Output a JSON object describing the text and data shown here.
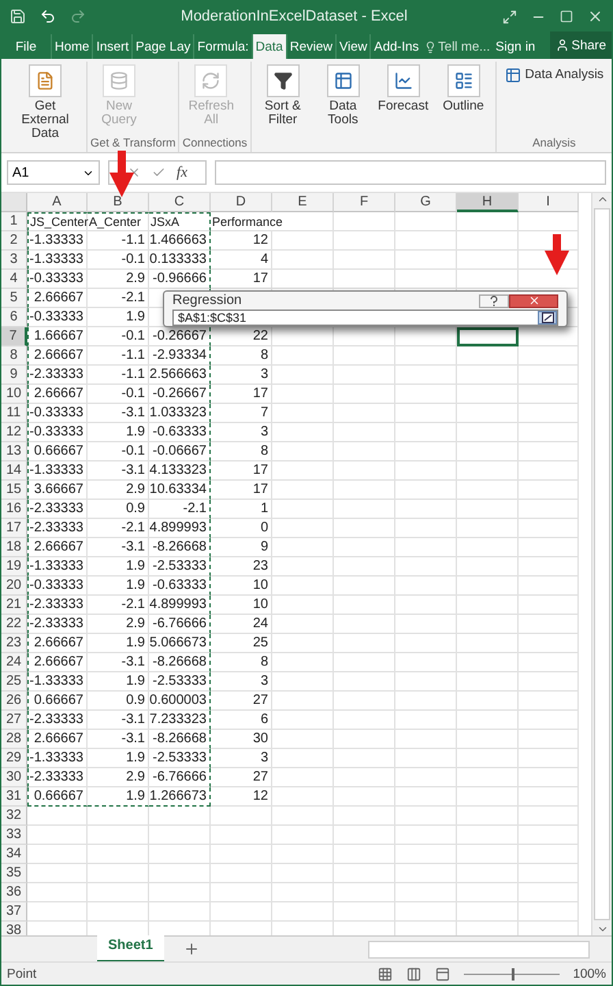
{
  "window": {
    "title": "ModerationInExcelDataset - Excel"
  },
  "tabs": [
    {
      "label": "File",
      "kind": "file",
      "selected": false
    },
    {
      "label": "Home",
      "kind": "tab",
      "selected": false
    },
    {
      "label": "Insert",
      "kind": "tab",
      "selected": false
    },
    {
      "label": "Page Lay",
      "kind": "tab",
      "selected": false
    },
    {
      "label": "Formula:",
      "kind": "tab",
      "selected": false
    },
    {
      "label": "Data",
      "kind": "tab",
      "selected": true
    },
    {
      "label": "Review",
      "kind": "tab",
      "selected": false
    },
    {
      "label": "View",
      "kind": "tab",
      "selected": false
    },
    {
      "label": "Add-Ins",
      "kind": "tab",
      "selected": false
    }
  ],
  "tell_me": {
    "placeholder": "Tell me..."
  },
  "sign_in": "Sign in",
  "share": "Share",
  "ribbon_groups": [
    {
      "buttons": [
        {
          "label": "Get External Data",
          "disabled": false
        }
      ]
    },
    {
      "label": "Get & Transform",
      "buttons": [
        {
          "label": "New Query",
          "disabled": true
        }
      ]
    },
    {
      "label": "Connections",
      "buttons": [
        {
          "label": "Refresh All",
          "disabled": true
        }
      ]
    },
    {
      "buttons": [
        {
          "label": "Sort & Filter",
          "disabled": false
        },
        {
          "label": "Data Tools",
          "disabled": false
        },
        {
          "label": "Forecast",
          "disabled": false
        },
        {
          "label": "Outline",
          "disabled": false
        }
      ]
    },
    {
      "label": "Analysis",
      "buttons": [
        {
          "label": "Data Analysis",
          "kind": "small",
          "disabled": false
        }
      ]
    }
  ],
  "formula_bar": {
    "name_box": "A1",
    "fx": "fx"
  },
  "columns": [
    {
      "label": "A",
      "selected": false,
      "in_marquee": true
    },
    {
      "label": "B",
      "selected": false,
      "in_marquee": true
    },
    {
      "label": "C",
      "selected": false,
      "in_marquee": true
    },
    {
      "label": "D",
      "selected": false,
      "in_marquee": false
    },
    {
      "label": "E",
      "selected": false,
      "in_marquee": false
    },
    {
      "label": "F",
      "selected": false,
      "in_marquee": false
    },
    {
      "label": "G",
      "selected": false,
      "in_marquee": false
    },
    {
      "label": "H",
      "selected": true,
      "in_marquee": false
    },
    {
      "label": "I",
      "selected": false,
      "in_marquee": false
    }
  ],
  "rows": [
    {
      "num": "1",
      "kind": "header",
      "selected": false,
      "in_marquee": true,
      "cells": [
        "JS_Center",
        "A_Center",
        "JSxA",
        "Performance"
      ]
    },
    {
      "num": "2",
      "kind": "data",
      "selected": false,
      "in_marquee": true,
      "cells": [
        "-1.33333",
        "-1.1",
        "1.466663",
        "12"
      ]
    },
    {
      "num": "3",
      "kind": "data",
      "selected": false,
      "in_marquee": true,
      "cells": [
        "-1.33333",
        "-0.1",
        "0.133333",
        "4"
      ]
    },
    {
      "num": "4",
      "kind": "data",
      "selected": false,
      "in_marquee": true,
      "cells": [
        "-0.33333",
        "2.9",
        "-0.96666",
        "17"
      ]
    },
    {
      "num": "5",
      "kind": "data",
      "selected": false,
      "in_marquee": true,
      "cells": [
        "2.66667",
        "-2.1",
        null,
        null
      ]
    },
    {
      "num": "6",
      "kind": "data",
      "selected": false,
      "in_marquee": true,
      "cells": [
        "-0.33333",
        "1.9",
        null,
        null
      ]
    },
    {
      "num": "7",
      "kind": "data",
      "selected": true,
      "in_marquee": true,
      "cells": [
        "1.66667",
        "-0.1",
        "-0.26667",
        "22"
      ]
    },
    {
      "num": "8",
      "kind": "data",
      "selected": false,
      "in_marquee": true,
      "cells": [
        "2.66667",
        "-1.1",
        "-2.93334",
        "8"
      ]
    },
    {
      "num": "9",
      "kind": "data",
      "selected": false,
      "in_marquee": true,
      "cells": [
        "-2.33333",
        "-1.1",
        "2.566663",
        "3"
      ]
    },
    {
      "num": "10",
      "kind": "data",
      "selected": false,
      "in_marquee": true,
      "cells": [
        "2.66667",
        "-0.1",
        "-0.26667",
        "17"
      ]
    },
    {
      "num": "11",
      "kind": "data",
      "selected": false,
      "in_marquee": true,
      "cells": [
        "-0.33333",
        "-3.1",
        "1.033323",
        "7"
      ]
    },
    {
      "num": "12",
      "kind": "data",
      "selected": false,
      "in_marquee": true,
      "cells": [
        "-0.33333",
        "1.9",
        "-0.63333",
        "3"
      ]
    },
    {
      "num": "13",
      "kind": "data",
      "selected": false,
      "in_marquee": true,
      "cells": [
        "0.66667",
        "-0.1",
        "-0.06667",
        "8"
      ]
    },
    {
      "num": "14",
      "kind": "data",
      "selected": false,
      "in_marquee": true,
      "cells": [
        "-1.33333",
        "-3.1",
        "4.133323",
        "17"
      ]
    },
    {
      "num": "15",
      "kind": "data",
      "selected": false,
      "in_marquee": true,
      "cells": [
        "3.66667",
        "2.9",
        "10.63334",
        "17"
      ]
    },
    {
      "num": "16",
      "kind": "data",
      "selected": false,
      "in_marquee": true,
      "cells": [
        "-2.33333",
        "0.9",
        "-2.1",
        "1"
      ]
    },
    {
      "num": "17",
      "kind": "data",
      "selected": false,
      "in_marquee": true,
      "cells": [
        "-2.33333",
        "-2.1",
        "4.899993",
        "0"
      ]
    },
    {
      "num": "18",
      "kind": "data",
      "selected": false,
      "in_marquee": true,
      "cells": [
        "2.66667",
        "-3.1",
        "-8.26668",
        "9"
      ]
    },
    {
      "num": "19",
      "kind": "data",
      "selected": false,
      "in_marquee": true,
      "cells": [
        "-1.33333",
        "1.9",
        "-2.53333",
        "23"
      ]
    },
    {
      "num": "20",
      "kind": "data",
      "selected": false,
      "in_marquee": true,
      "cells": [
        "-0.33333",
        "1.9",
        "-0.63333",
        "10"
      ]
    },
    {
      "num": "21",
      "kind": "data",
      "selected": false,
      "in_marquee": true,
      "cells": [
        "-2.33333",
        "-2.1",
        "4.899993",
        "10"
      ]
    },
    {
      "num": "22",
      "kind": "data",
      "selected": false,
      "in_marquee": true,
      "cells": [
        "-2.33333",
        "2.9",
        "-6.76666",
        "24"
      ]
    },
    {
      "num": "23",
      "kind": "data",
      "selected": false,
      "in_marquee": true,
      "cells": [
        "2.66667",
        "1.9",
        "5.066673",
        "25"
      ]
    },
    {
      "num": "24",
      "kind": "data",
      "selected": false,
      "in_marquee": true,
      "cells": [
        "2.66667",
        "-3.1",
        "-8.26668",
        "8"
      ]
    },
    {
      "num": "25",
      "kind": "data",
      "selected": false,
      "in_marquee": true,
      "cells": [
        "-1.33333",
        "1.9",
        "-2.53333",
        "3"
      ]
    },
    {
      "num": "26",
      "kind": "data",
      "selected": false,
      "in_marquee": true,
      "cells": [
        "0.66667",
        "0.9",
        "0.600003",
        "27"
      ]
    },
    {
      "num": "27",
      "kind": "data",
      "selected": false,
      "in_marquee": true,
      "cells": [
        "-2.33333",
        "-3.1",
        "7.233323",
        "6"
      ]
    },
    {
      "num": "28",
      "kind": "data",
      "selected": false,
      "in_marquee": true,
      "cells": [
        "2.66667",
        "-3.1",
        "-8.26668",
        "30"
      ]
    },
    {
      "num": "29",
      "kind": "data",
      "selected": false,
      "in_marquee": true,
      "cells": [
        "-1.33333",
        "1.9",
        "-2.53333",
        "3"
      ]
    },
    {
      "num": "30",
      "kind": "data",
      "selected": false,
      "in_marquee": true,
      "cells": [
        "-2.33333",
        "2.9",
        "-6.76666",
        "27"
      ]
    },
    {
      "num": "31",
      "kind": "data",
      "selected": false,
      "in_marquee": true,
      "cells": [
        "0.66667",
        "1.9",
        "1.266673",
        "12"
      ]
    },
    {
      "num": "32",
      "kind": "data",
      "selected": false,
      "in_marquee": false,
      "cells": []
    },
    {
      "num": "33",
      "kind": "data",
      "selected": false,
      "in_marquee": false,
      "cells": []
    },
    {
      "num": "34",
      "kind": "data",
      "selected": false,
      "in_marquee": false,
      "cells": []
    },
    {
      "num": "35",
      "kind": "data",
      "selected": false,
      "in_marquee": false,
      "cells": []
    },
    {
      "num": "36",
      "kind": "data",
      "selected": false,
      "in_marquee": false,
      "cells": []
    },
    {
      "num": "37",
      "kind": "data",
      "selected": false,
      "in_marquee": false,
      "cells": []
    },
    {
      "num": "38",
      "kind": "data",
      "selected": false,
      "in_marquee": false,
      "cells": []
    }
  ],
  "dialog": {
    "title": "Regression",
    "value": "$A$1:$C$31"
  },
  "sheet_tabs": [
    {
      "label": "Sheet1",
      "selected": true
    }
  ],
  "status_bar": {
    "text": "Point",
    "zoom": "100%",
    "level": 0.5
  }
}
